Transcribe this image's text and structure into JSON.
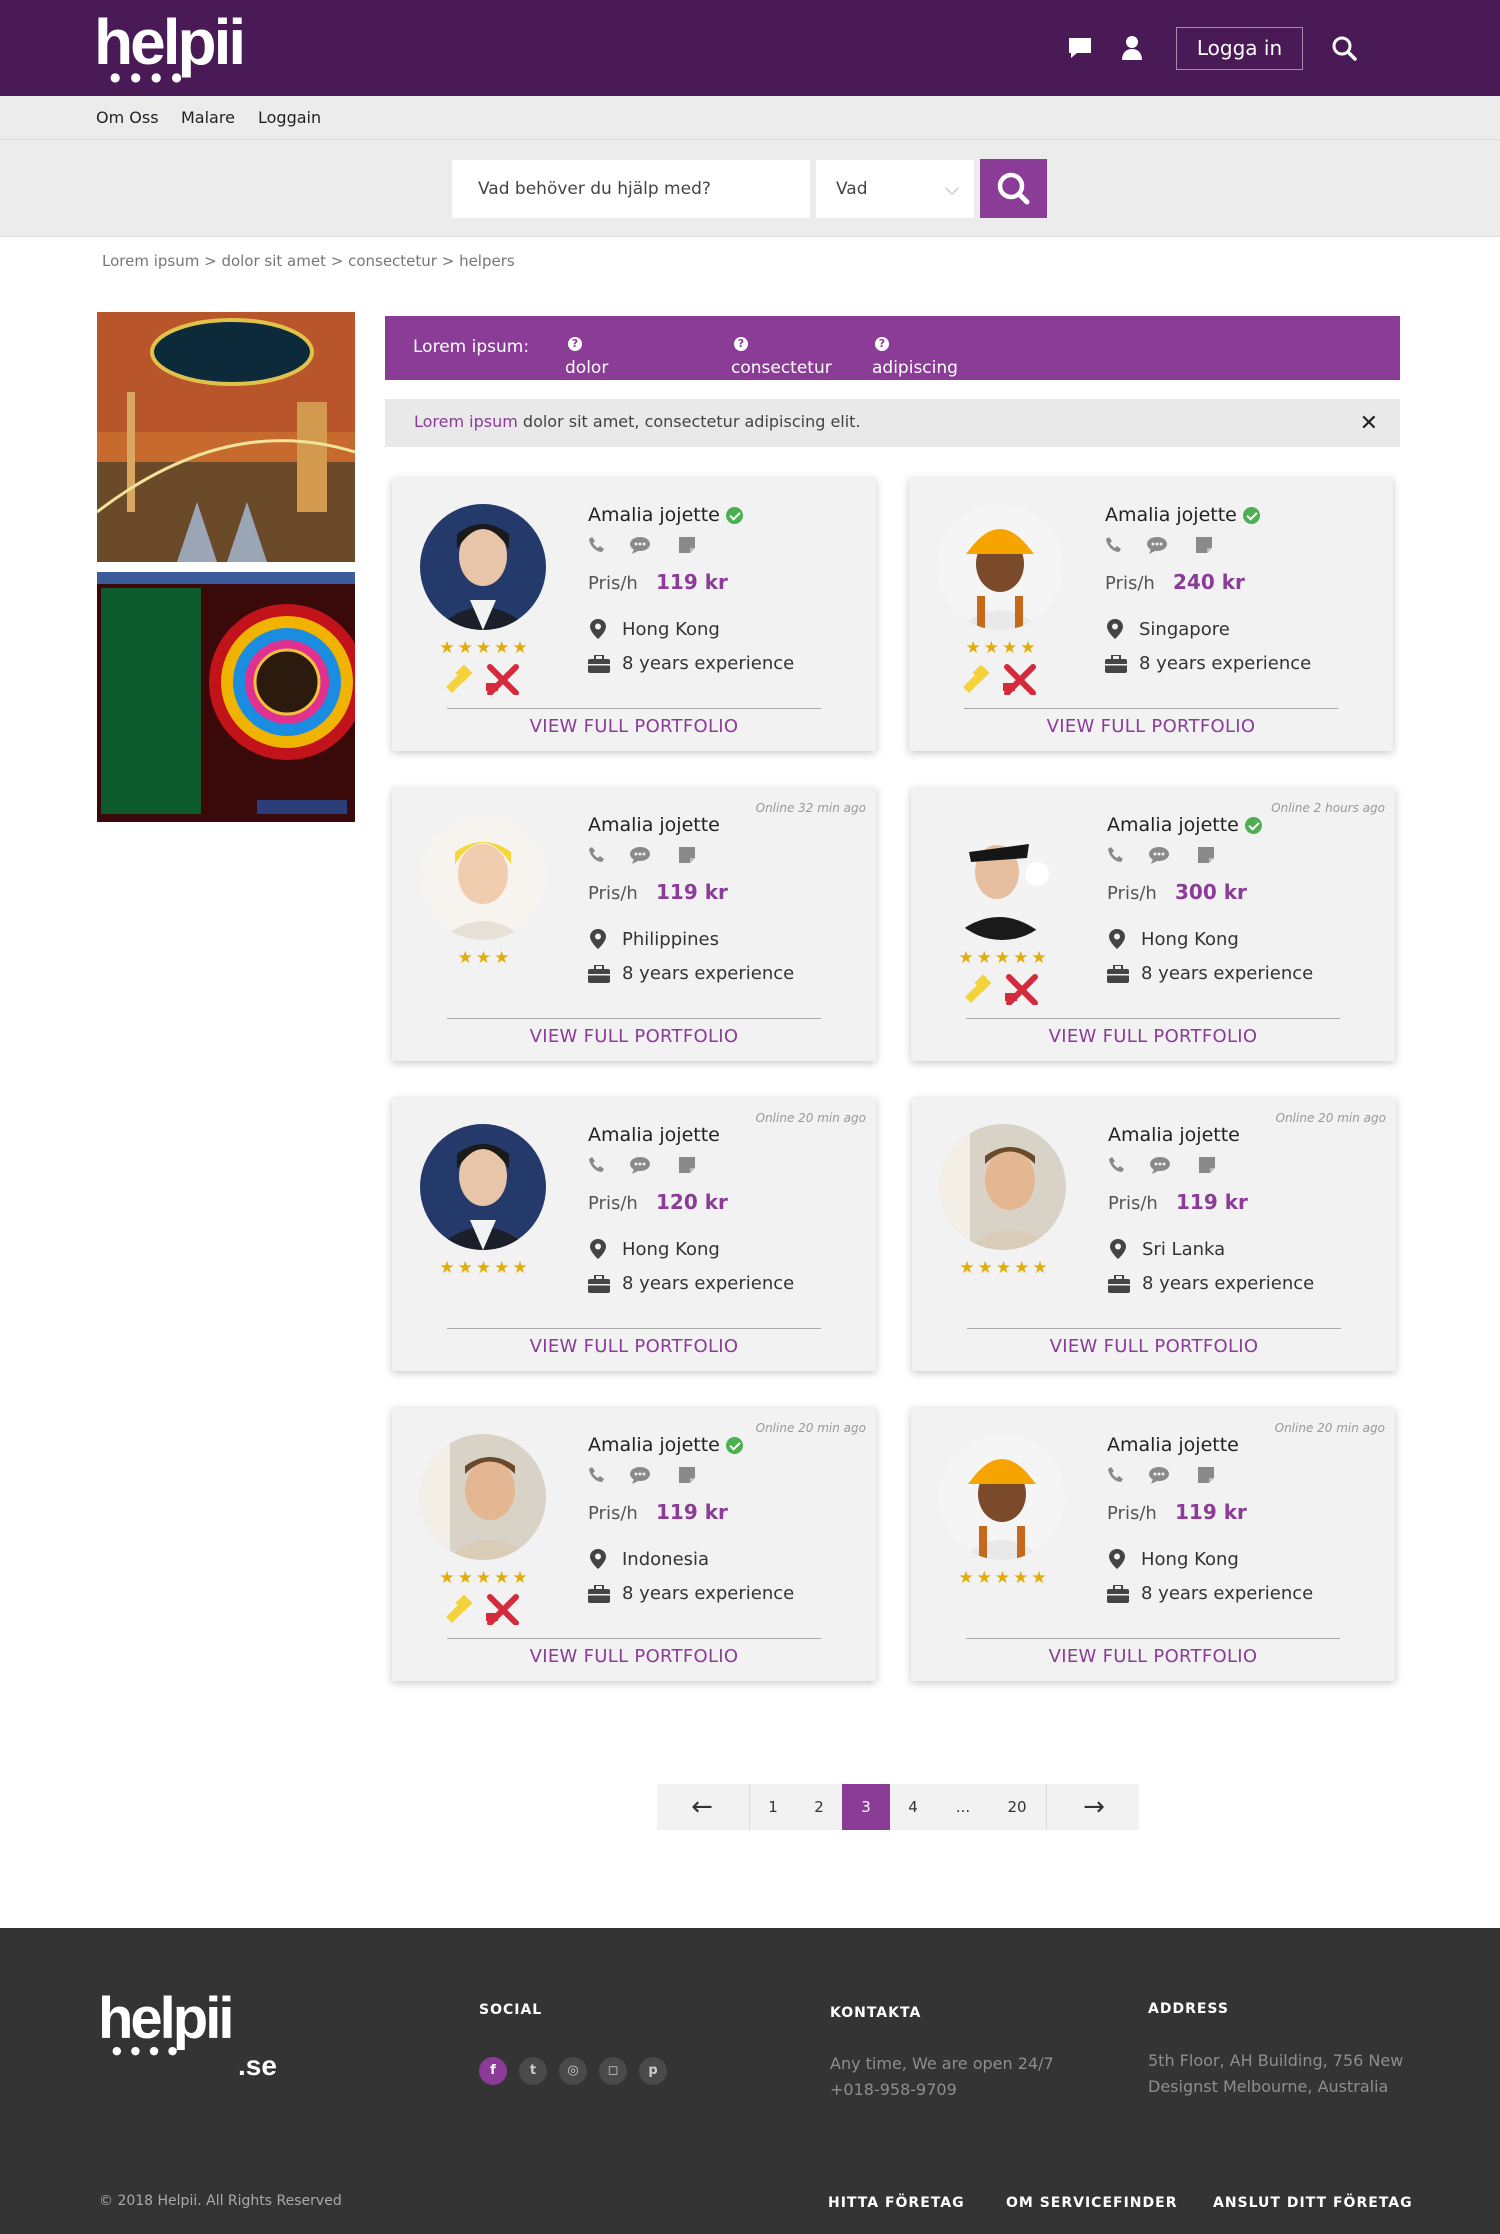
{
  "brand": {
    "logo_text": "helpii",
    "footer_logo_text": "helpii",
    "footer_logo_suffix": ".se"
  },
  "header": {
    "login_label": "Logga in"
  },
  "subnav": {
    "items": [
      "Om Oss",
      "Malare",
      "Loggain"
    ]
  },
  "search": {
    "placeholder": "Vad behöver du hjälp med?",
    "select_value": "Vad"
  },
  "breadcrumb": "Lorem ipsum > dolor sit amet > consectetur > helpers",
  "filters": {
    "label": "Lorem ipsum:",
    "items": [
      "dolor sit amet",
      "consectetur",
      "adipiscing elit."
    ],
    "active": "consectetur",
    "help_glyph": "?"
  },
  "notice": {
    "highlight": "Lorem ipsum",
    "text": " dolor sit amet, consectetur adipiscing elit.",
    "close": "✕"
  },
  "ads": [
    {
      "name": "Camel Casino ad"
    },
    {
      "name": "Wheel of Riches ad"
    }
  ],
  "cards": [
    {
      "name": "Amalia jojette",
      "verified": true,
      "online": "",
      "price_label": "Pris/h",
      "price": "119 kr",
      "location": "Hong Kong",
      "experience": "8 years experience",
      "stars": 5,
      "badges": true,
      "avatar": "woman-dark",
      "portfolio": "VIEW FULL PORTFOLIO"
    },
    {
      "name": "Amalia jojette",
      "verified": true,
      "online": "",
      "price_label": "Pris/h",
      "price": "240 kr",
      "location": "Singapore",
      "experience": "8 years experience",
      "stars": 4,
      "badges": true,
      "avatar": "worker-helmet",
      "portfolio": "VIEW FULL PORTFOLIO"
    },
    {
      "name": "Amalia jojette",
      "verified": false,
      "online": "Online 32 min ago",
      "price_label": "Pris/h",
      "price": "119 kr",
      "location": "Philippines",
      "experience": "8 years experience",
      "stars": 3,
      "badges": false,
      "avatar": "woman-yellow",
      "portfolio": "VIEW FULL PORTFOLIO"
    },
    {
      "name": "Amalia jojette",
      "verified": true,
      "online": "Online 2 hours ago",
      "price_label": "Pris/h",
      "price": "300 kr",
      "location": "Hong Kong",
      "experience": "8 years experience",
      "stars": 5,
      "badges": true,
      "avatar": "chauffeur",
      "portfolio": "VIEW FULL PORTFOLIO"
    },
    {
      "name": "Amalia jojette",
      "verified": false,
      "online": "Online 20 min ago",
      "price_label": "Pris/h",
      "price": "120 kr",
      "location": "Hong Kong",
      "experience": "8 years experience",
      "stars": 5,
      "badges": false,
      "avatar": "woman-dark",
      "portfolio": "VIEW FULL PORTFOLIO"
    },
    {
      "name": "Amalia jojette",
      "verified": false,
      "online": "Online 20 min ago",
      "price_label": "Pris/h",
      "price": "119 kr",
      "location": "Sri Lanka",
      "experience": "8 years experience",
      "stars": 5,
      "badges": false,
      "avatar": "man-smile",
      "portfolio": "VIEW FULL PORTFOLIO"
    },
    {
      "name": "Amalia jojette",
      "verified": true,
      "online": "Online 20 min ago",
      "price_label": "Pris/h",
      "price": "119 kr",
      "location": "Indonesia",
      "experience": "8 years experience",
      "stars": 5,
      "badges": true,
      "avatar": "man-smile",
      "portfolio": "VIEW FULL PORTFOLIO"
    },
    {
      "name": "Amalia jojette",
      "verified": false,
      "online": "Online 20 min ago",
      "price_label": "Pris/h",
      "price": "119 kr",
      "location": "Hong Kong",
      "experience": "8 years experience",
      "stars": 5,
      "badges": false,
      "avatar": "worker-helmet",
      "portfolio": "VIEW FULL PORTFOLIO"
    }
  ],
  "pagination": {
    "prev": "←",
    "pages": [
      "1",
      "2",
      "3",
      "4",
      "...",
      "20"
    ],
    "current": "3",
    "next": "→"
  },
  "footer": {
    "social_title": "SOCIAL",
    "contact_title": "KONTAKTA",
    "contact_lines": [
      "Any time, We are open 24/7",
      "+018-958-9709"
    ],
    "address_title": "ADDRESS",
    "address_lines": [
      "5th Floor, AH Building, 756 New",
      "Designst Melbourne, Australia"
    ],
    "social_icons": [
      "facebook-icon",
      "twitter-icon",
      "dribbble-icon",
      "instagram-icon",
      "pinterest-icon"
    ],
    "copyright": "© 2018 Helpii. All Rights Reserved",
    "links": [
      "HITTA FÖRETAG",
      "OM SERVICEFINDER",
      "ANSLUT DITT FÖRETAG"
    ]
  },
  "colors": {
    "brand_purple": "#8a3c97",
    "topbar": "#4a1a57",
    "footer": "#343434",
    "star": "#e2ad0a",
    "verified": "#4caf50"
  }
}
